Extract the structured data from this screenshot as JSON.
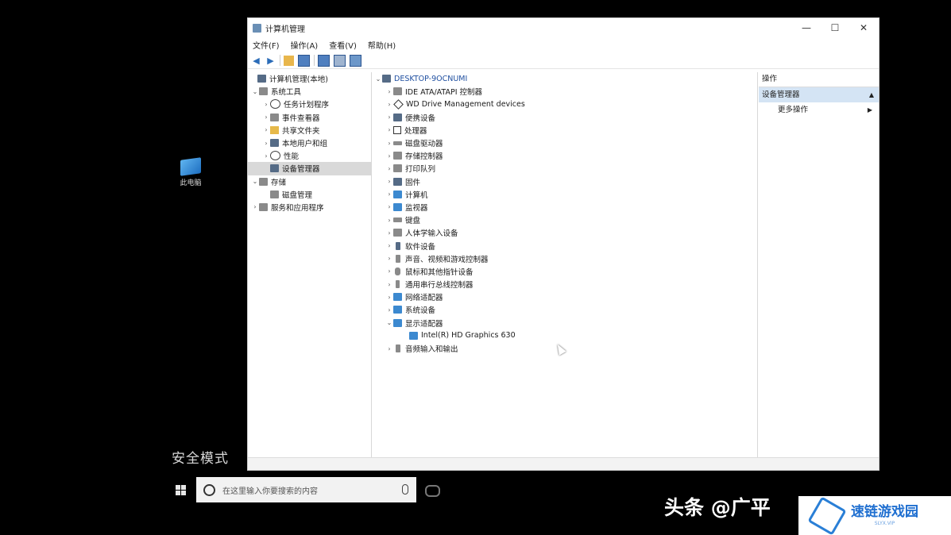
{
  "desktop": {
    "icon_label": "此电脑",
    "safe_mode_label": "安全模式"
  },
  "taskbar": {
    "search_placeholder": "在这里输入你要搜索的内容"
  },
  "watermark": {
    "text": "头条 @广平",
    "badge_text": "速链游戏园",
    "badge_sub": "SLYX.VIP"
  },
  "window": {
    "title": "计算机管理",
    "controls": {
      "minimize": "—",
      "maximize": "☐",
      "close": "✕"
    },
    "menu": [
      "文件(F)",
      "操作(A)",
      "查看(V)",
      "帮助(H)"
    ],
    "left_tree": [
      {
        "label": "计算机管理(本地)",
        "arrow": "",
        "indent": 0,
        "icon": "computer-management-icon"
      },
      {
        "label": "系统工具",
        "arrow": "v",
        "indent": 1,
        "icon": "system-tools-icon"
      },
      {
        "label": "任务计划程序",
        "arrow": ">",
        "indent": 2,
        "icon": "clock-icon"
      },
      {
        "label": "事件查看器",
        "arrow": ">",
        "indent": 2,
        "icon": "event-viewer-icon"
      },
      {
        "label": "共享文件夹",
        "arrow": ">",
        "indent": 2,
        "icon": "shared-folder-icon"
      },
      {
        "label": "本地用户和组",
        "arrow": ">",
        "indent": 2,
        "icon": "users-icon"
      },
      {
        "label": "性能",
        "arrow": ">",
        "indent": 2,
        "icon": "performance-icon"
      },
      {
        "label": "设备管理器",
        "arrow": "",
        "indent": 2,
        "icon": "device-manager-icon",
        "selected": true
      },
      {
        "label": "存储",
        "arrow": "v",
        "indent": 1,
        "icon": "storage-icon"
      },
      {
        "label": "磁盘管理",
        "arrow": "",
        "indent": 2,
        "icon": "disk-management-icon"
      },
      {
        "label": "服务和应用程序",
        "arrow": ">",
        "indent": 1,
        "icon": "services-icon"
      }
    ],
    "device_tree": [
      {
        "label": "DESKTOP-9OCNUMI",
        "arrow": "v",
        "indent": 0,
        "icon": "computer-icon"
      },
      {
        "label": "IDE ATA/ATAPI 控制器",
        "arrow": ">",
        "indent": 1,
        "icon": "ide-controller-icon"
      },
      {
        "label": "WD Drive Management devices",
        "arrow": ">",
        "indent": 1,
        "icon": "diamond-icon"
      },
      {
        "label": "便携设备",
        "arrow": ">",
        "indent": 1,
        "icon": "portable-device-icon"
      },
      {
        "label": "处理器",
        "arrow": ">",
        "indent": 1,
        "icon": "processor-icon"
      },
      {
        "label": "磁盘驱动器",
        "arrow": ">",
        "indent": 1,
        "icon": "disk-drive-icon"
      },
      {
        "label": "存储控制器",
        "arrow": ">",
        "indent": 1,
        "icon": "storage-controller-icon"
      },
      {
        "label": "打印队列",
        "arrow": ">",
        "indent": 1,
        "icon": "print-queue-icon"
      },
      {
        "label": "固件",
        "arrow": ">",
        "indent": 1,
        "icon": "firmware-icon"
      },
      {
        "label": "计算机",
        "arrow": ">",
        "indent": 1,
        "icon": "computer-icon"
      },
      {
        "label": "监视器",
        "arrow": ">",
        "indent": 1,
        "icon": "monitor-icon"
      },
      {
        "label": "键盘",
        "arrow": ">",
        "indent": 1,
        "icon": "keyboard-icon"
      },
      {
        "label": "人体学输入设备",
        "arrow": ">",
        "indent": 1,
        "icon": "hid-icon"
      },
      {
        "label": "软件设备",
        "arrow": ">",
        "indent": 1,
        "icon": "software-device-icon"
      },
      {
        "label": "声音、视频和游戏控制器",
        "arrow": ">",
        "indent": 1,
        "icon": "sound-icon"
      },
      {
        "label": "鼠标和其他指针设备",
        "arrow": ">",
        "indent": 1,
        "icon": "mouse-icon"
      },
      {
        "label": "通用串行总线控制器",
        "arrow": ">",
        "indent": 1,
        "icon": "usb-icon"
      },
      {
        "label": "网络适配器",
        "arrow": ">",
        "indent": 1,
        "icon": "network-adapter-icon"
      },
      {
        "label": "系统设备",
        "arrow": ">",
        "indent": 1,
        "icon": "system-device-icon"
      },
      {
        "label": "显示适配器",
        "arrow": "v",
        "indent": 1,
        "icon": "display-adapter-icon"
      },
      {
        "label": "Intel(R) HD Graphics 630",
        "arrow": "",
        "indent": 2,
        "icon": "display-adapter-icon"
      },
      {
        "label": "音频输入和输出",
        "arrow": ">",
        "indent": 1,
        "icon": "audio-io-icon"
      }
    ],
    "actions": {
      "header": "操作",
      "section": "设备管理器",
      "more": "更多操作"
    }
  }
}
